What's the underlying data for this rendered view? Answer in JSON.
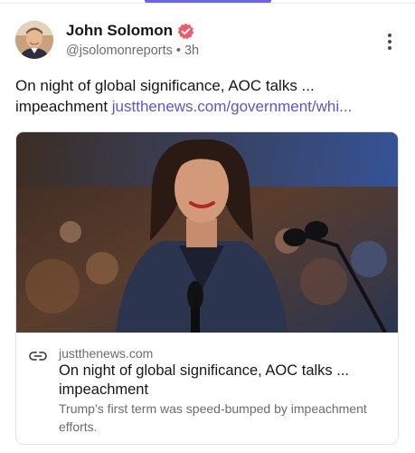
{
  "post": {
    "author_name": "John Solomon",
    "handle": "@jsolomonreports",
    "separator": "•",
    "time": "3h",
    "text": "On night of global significance, AOC talks ... impeachment ",
    "link_text": "justthenews.com/government/whi..."
  },
  "link_preview": {
    "domain": "justthenews.com",
    "title": "On night of global significance, AOC talks ... impeachment",
    "description": "Trump’s first term was speed-bumped by impeachment efforts."
  },
  "colors": {
    "accent": "#5b55d6",
    "verified_badge": "#ef5b6c",
    "text_primary": "#16151d",
    "text_secondary": "#6c6b75"
  },
  "icons": {
    "verified": "verified-badge-icon",
    "more": "more-vertical-icon",
    "link": "link-chain-icon"
  }
}
